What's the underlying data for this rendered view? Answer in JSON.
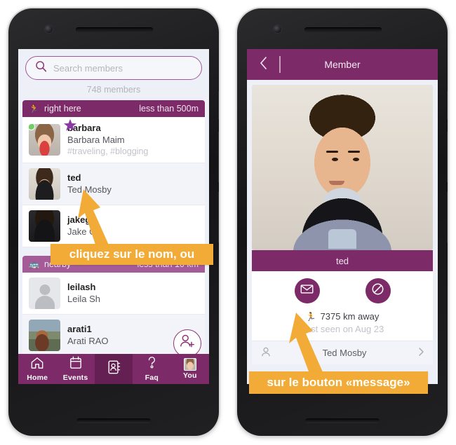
{
  "accent": {
    "purple_dark": "#7c2a68",
    "purple_light": "#a45b98",
    "purple_line": "#a0579b",
    "orange": "#f2ab36",
    "online_green": "#6ed063"
  },
  "left_phone": {
    "screen_name": "member-list",
    "search": {
      "placeholder": "Search members",
      "value": "",
      "icon": "search-icon"
    },
    "members_count": "748 members",
    "groups": [
      {
        "id": "right-here",
        "emoji": "🏃",
        "title": "right here",
        "distance": "less than 500m",
        "members": [
          {
            "nick": "barbara",
            "fullname": "Barbara Maim",
            "tags": "#traveling, #blogging",
            "online": true,
            "starred": true,
            "avatar": "av-barbara"
          },
          {
            "nick": "ted",
            "fullname": "Ted Mosby",
            "tags": "",
            "online": false,
            "starred": false,
            "avatar": "av-ted"
          },
          {
            "nick": "jakeg",
            "fullname": "Jake G",
            "tags": "",
            "online": false,
            "starred": false,
            "avatar": "av-jake"
          }
        ]
      },
      {
        "id": "nearby",
        "emoji": "🚌",
        "title": "nearby",
        "distance": "less than 10 km",
        "members": [
          {
            "nick": "leilash",
            "fullname": "Leila Sh",
            "tags": "",
            "online": false,
            "starred": false,
            "avatar": "av-blank"
          },
          {
            "nick": "arati1",
            "fullname": "Arati RAO",
            "tags": "",
            "online": false,
            "starred": false,
            "avatar": "av-arati"
          }
        ]
      }
    ],
    "add_member_button": "add-member-icon",
    "tabbar": [
      {
        "id": "home",
        "label": "Home",
        "icon": "home-icon",
        "active": false
      },
      {
        "id": "events",
        "label": "Events",
        "icon": "calendar-icon",
        "active": false
      },
      {
        "id": "members",
        "label": "",
        "icon": "contacts-icon",
        "active": true
      },
      {
        "id": "faq",
        "label": "Faq",
        "icon": "question-icon",
        "active": false
      },
      {
        "id": "you",
        "label": "You",
        "icon": "avatar-icon",
        "active": false
      }
    ]
  },
  "right_phone": {
    "screen_name": "member-detail",
    "app_bar": {
      "back": "back-chevron-icon",
      "title": "Member"
    },
    "member_name": "ted",
    "actions": [
      {
        "id": "message",
        "icon": "envelope-icon"
      },
      {
        "id": "block",
        "icon": "block-icon"
      }
    ],
    "distance_emoji": "🏃",
    "distance": "7375 km away",
    "last_seen": "Last seen on Aug 23",
    "sub_row": {
      "label": "Ted Mosby",
      "left_icon": "person-icon",
      "right_icon": "chevron-icon"
    }
  },
  "callouts": [
    {
      "id": "callout-name",
      "text": "cliquez sur le nom, ou"
    },
    {
      "id": "callout-message",
      "text": "sur le bouton «message»"
    }
  ]
}
